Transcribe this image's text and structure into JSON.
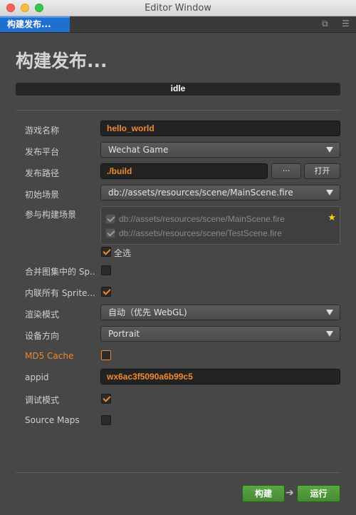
{
  "window": {
    "title": "Editor Window"
  },
  "tab": {
    "label": "构建发布..."
  },
  "header": {
    "title": "构建发布...",
    "progress_label": "idle",
    "progress_value": 0
  },
  "form": {
    "game_name": {
      "label": "游戏名称",
      "value": "hello_world"
    },
    "platform": {
      "label": "发布平台",
      "value": "Wechat Game"
    },
    "build_path": {
      "label": "发布路径",
      "value": "./build",
      "browse_label": "···",
      "open_label": "打开"
    },
    "start_scene": {
      "label": "初始场景",
      "value": "db://assets/resources/scene/MainScene.fire"
    },
    "scenes": {
      "label": "参与构建场景",
      "items": [
        {
          "path": "db://assets/resources/scene/MainScene.fire",
          "checked": true,
          "starred": true
        },
        {
          "path": "db://assets/resources/scene/TestScene.fire",
          "checked": true,
          "starred": false
        }
      ],
      "select_all_label": "全选",
      "select_all_checked": true
    },
    "merge_atlas": {
      "label": "合并图集中的 Sp..",
      "checked": false
    },
    "inline_spriteframes": {
      "label": "内联所有 Sprite...",
      "checked": true
    },
    "render_mode": {
      "label": "渲染模式",
      "value": "自动（优先 WebGL)"
    },
    "orientation": {
      "label": "设备方向",
      "value": "Portrait"
    },
    "md5_cache": {
      "label": "MD5 Cache",
      "checked": false
    },
    "appid": {
      "label": "appid",
      "value": "wx6ac3f5090a6b99c5"
    },
    "debug": {
      "label": "调试模式",
      "checked": true
    },
    "source_maps": {
      "label": "Source Maps",
      "checked": false
    }
  },
  "footer": {
    "build_label": "构建",
    "run_label": "运行"
  },
  "colors": {
    "accent": "#f0882a",
    "tab_blue": "#1f6fcf",
    "button_green": "#4f9a3a"
  }
}
